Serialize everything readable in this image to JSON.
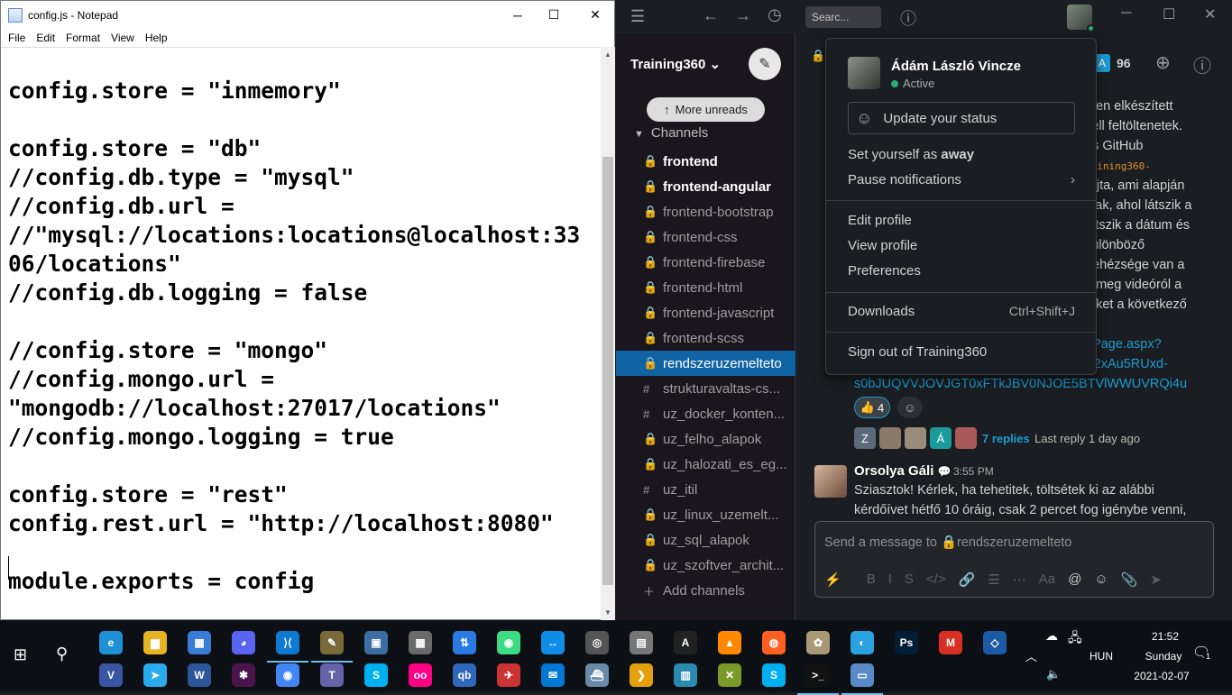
{
  "notepad": {
    "title": "config.js - Notepad",
    "menu": [
      "File",
      "Edit",
      "Format",
      "View",
      "Help"
    ],
    "code_lines": [
      "config.store = \"inmemory\"",
      "",
      "config.store = \"db\"",
      "//config.db.type = \"mysql\"",
      "//config.db.url =",
      "//\"mysql://locations:locations@localhost:33",
      "06/locations\"",
      "//config.db.logging = false",
      "",
      "//config.store = \"mongo\"",
      "//config.mongo.url =",
      "\"mongodb://localhost:27017/locations\"",
      "//config.mongo.logging = true",
      "",
      "config.store = \"rest\"",
      "config.rest.url = \"http://localhost:8080\"",
      "",
      "module.exports = config"
    ],
    "controls": {
      "minimize": "─",
      "maximize": "☐",
      "close": "✕"
    }
  },
  "slack": {
    "search_placeholder": "Searc...",
    "workspace": "Training360",
    "more_unreads": "More unreads",
    "channels_header": "Channels",
    "channels": [
      {
        "name": "frontend",
        "prefix": "lock",
        "bold": true
      },
      {
        "name": "frontend-angular",
        "prefix": "lock",
        "bold": true
      },
      {
        "name": "frontend-bootstrap",
        "prefix": "lock",
        "bold": false
      },
      {
        "name": "frontend-css",
        "prefix": "lock",
        "bold": false
      },
      {
        "name": "frontend-firebase",
        "prefix": "lock",
        "bold": false
      },
      {
        "name": "frontend-html",
        "prefix": "lock",
        "bold": false
      },
      {
        "name": "frontend-javascript",
        "prefix": "lock",
        "bold": false
      },
      {
        "name": "frontend-scss",
        "prefix": "lock",
        "bold": false
      },
      {
        "name": "rendszeruzemelteto",
        "prefix": "lock",
        "bold": false,
        "selected": true
      },
      {
        "name": "strukturavaltas-cs...",
        "prefix": "hash",
        "bold": false
      },
      {
        "name": "uz_docker_konten...",
        "prefix": "hash",
        "bold": false
      },
      {
        "name": "uz_felho_alapok",
        "prefix": "lock",
        "bold": false
      },
      {
        "name": "uz_halozati_es_eg...",
        "prefix": "lock",
        "bold": false
      },
      {
        "name": "uz_itil",
        "prefix": "hash",
        "bold": false
      },
      {
        "name": "uz_linux_uzemelt...",
        "prefix": "lock",
        "bold": false
      },
      {
        "name": "uz_sql_alapok",
        "prefix": "lock",
        "bold": false
      },
      {
        "name": "uz_szoftver_archit...",
        "prefix": "lock",
        "bold": false
      }
    ],
    "add_channels": "Add channels",
    "member_count": "96",
    "message_fragments": [
      "éten elkészített",
      "kell feltöltenetek.",
      "és GitHub",
      "raining360-",
      "rajta, ami alapján",
      "olak, ahol látszik a",
      "látszik a dátum és",
      "különböző",
      "nehézsége van a",
      "e meg videóról a",
      "teket a következő"
    ],
    "link_lines": [
      "ePage.aspx?",
      "A2xAu5RUxd-",
      "s0bJUQVVJOVJGT0xFTkJBV0NJOE5BTVlWWUVRQi4u"
    ],
    "reaction": {
      "emoji": "👍",
      "count": "4"
    },
    "reply_avatars": [
      "Z",
      "",
      "",
      "Á",
      ""
    ],
    "replies": "7 replies",
    "last_reply": "Last reply 1 day ago",
    "message": {
      "author": "Orsolya Gáli",
      "time": "3:55 PM",
      "lines": [
        "Sziasztok! Kérlek, ha tehetitek, töltsétek ki az alábbi",
        "kérdőívet hétfő 10 óráig, csak 2 percet fog igénybe venni,"
      ]
    },
    "composer_placeholder": "Send a message to 🔒rendszeruzemelteto",
    "composer_tools": [
      "⚡",
      "B",
      "I",
      "S",
      "</>",
      "🔗",
      "☰",
      "⋯",
      "Aa",
      "@",
      "☺",
      "📎",
      "➤"
    ]
  },
  "profile_menu": {
    "name": "Ádám László Vincze",
    "status": "Active",
    "update_status": "Update your status",
    "set_away_prefix": "Set yourself as ",
    "set_away_bold": "away",
    "pause_notifications": "Pause notifications",
    "edit_profile": "Edit profile",
    "view_profile": "View profile",
    "preferences": "Preferences",
    "downloads": "Downloads",
    "downloads_shortcut": "Ctrl+Shift+J",
    "sign_out": "Sign out of Training360"
  },
  "taskbar": {
    "time": "21:52",
    "day": "Sunday",
    "date": "2021-02-07",
    "language": "HUN",
    "notification_count": "1"
  }
}
